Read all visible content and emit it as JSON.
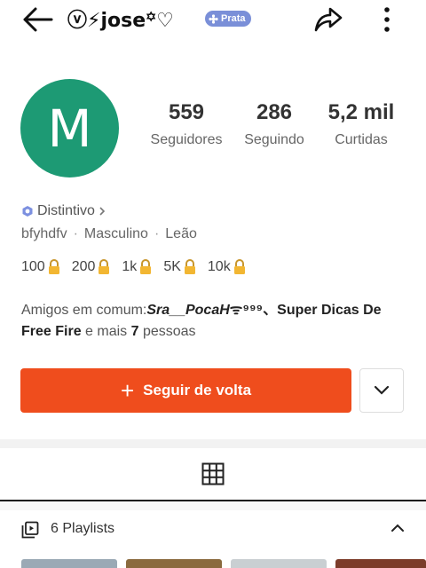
{
  "header": {
    "title": "ⓥ⚡jose꙳♡",
    "badge_label": "Prata",
    "back_icon": "arrow-left-icon",
    "share_icon": "share-arrow-icon",
    "more_icon": "vertical-dots-icon"
  },
  "profile": {
    "avatar_letter": "M",
    "avatar_color": "#1d9a74",
    "stats": [
      {
        "value": "559",
        "label": "Seguidores"
      },
      {
        "value": "286",
        "label": "Seguindo"
      },
      {
        "value": "5,2 mil",
        "label": "Curtidas"
      }
    ],
    "badge_link": "Distintivo",
    "meta": [
      "bfyhdfv",
      "Masculino",
      "Leão"
    ],
    "levels": [
      "100",
      "200",
      "1k",
      "5K",
      "10k"
    ]
  },
  "friends": {
    "prefix": "Amigos em comum:",
    "friend1": "Sra__PocaH",
    "friend1_suffix": "ᯤ⁹⁹⁹、",
    "friend2": "Super Dicas De Free Fire",
    "middle": " e mais ",
    "count": "7",
    "suffix": " pessoas"
  },
  "actions": {
    "follow_back_label": "Seguir de volta",
    "accent_color": "#ef4d1d"
  },
  "playlists": {
    "label": "6 Playlists"
  }
}
